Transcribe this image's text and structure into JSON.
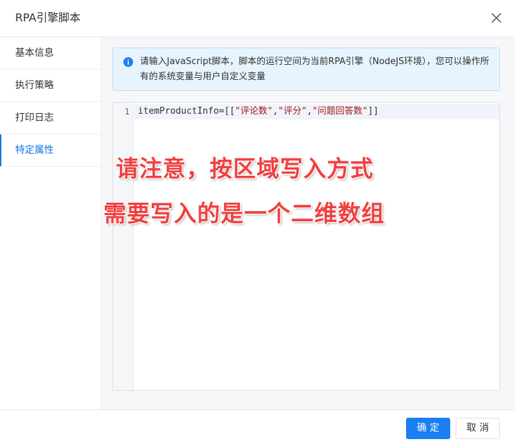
{
  "dialog": {
    "title": "RPA引擎脚本",
    "close_icon": "close-icon"
  },
  "sidebar": {
    "items": [
      {
        "label": "基本信息",
        "active": false
      },
      {
        "label": "执行策略",
        "active": false
      },
      {
        "label": "打印日志",
        "active": false
      },
      {
        "label": "特定属性",
        "active": true
      }
    ]
  },
  "alert": {
    "icon": "info-icon",
    "text": "请输入JavaScript脚本，脚本的运行空间为当前RPA引擎（NodeJS环境），您可以操作所有的系统变量与用户自定义变量"
  },
  "editor": {
    "line_number": "1",
    "code": {
      "prefix": "itemProductInfo=[[",
      "str1": "\"评论数\"",
      "sep1": ",",
      "str2": "\"评分\"",
      "sep2": ",",
      "str3": "\"问题回答数\"",
      "suffix": "]]"
    }
  },
  "annotation": {
    "line1": "请注意，按区域写入方式",
    "line2": "需要写入的是一个二维数组"
  },
  "footer": {
    "confirm_label": "确 定",
    "cancel_label": "取 消"
  },
  "colors": {
    "primary": "#1a7ff0",
    "annotation": "#f04040",
    "alert_bg": "#e8f4fd"
  }
}
